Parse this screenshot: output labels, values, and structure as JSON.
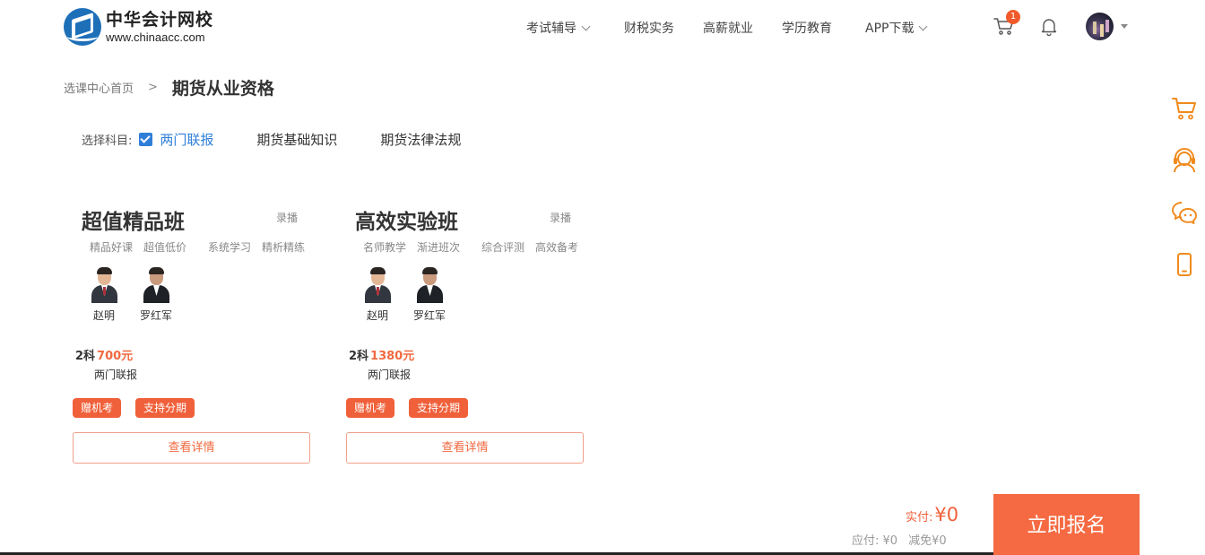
{
  "header": {
    "logo_cn": "中华会计网校",
    "logo_en": "www.chinaacc.com",
    "nav": [
      {
        "label": "考试辅导",
        "dropdown": true
      },
      {
        "label": "财税实务",
        "dropdown": false
      },
      {
        "label": "高薪就业",
        "dropdown": false
      },
      {
        "label": "学历教育",
        "dropdown": false
      },
      {
        "label": "APP下载",
        "dropdown": true
      }
    ],
    "cart_count": "1",
    "icons": [
      "cart-icon",
      "bell-icon",
      "avatar",
      "caret-down-icon"
    ]
  },
  "breadcrumb": {
    "home": "选课中心首页",
    "separator": ">",
    "current": "期货从业资格"
  },
  "subjects": {
    "label": "选择科目:",
    "options": [
      {
        "label": "两门联报",
        "checked": true
      },
      {
        "label": "期货基础知识",
        "checked": false
      },
      {
        "label": "期货法律法规",
        "checked": false
      }
    ]
  },
  "cards": [
    {
      "title": "超值精品班",
      "type": "录播",
      "tags": [
        "精品好课",
        "超值低价",
        "系统学习",
        "精析精练"
      ],
      "teachers": [
        "赵明",
        "罗红军"
      ],
      "count": "2科",
      "price": "700元",
      "desc": "两门联报",
      "badges": [
        "赠机考",
        "支持分期"
      ],
      "button": "查看详情"
    },
    {
      "title": "高效实验班",
      "type": "录播",
      "tags": [
        "名师教学",
        "渐进班次",
        "综合评测",
        "高效备考"
      ],
      "teachers": [
        "赵明",
        "罗红军"
      ],
      "count": "2科",
      "price": "1380元",
      "desc": "两门联报",
      "badges": [
        "赠机考",
        "支持分期"
      ],
      "button": "查看详情"
    }
  ],
  "sidebar": {
    "icons": [
      "cart-icon",
      "customer-service-icon",
      "wechat-icon",
      "mobile-icon"
    ],
    "accent": "#f08a1c"
  },
  "checkout": {
    "paid_label": "实付:",
    "paid_amount": "¥0",
    "due": "应付: ¥0",
    "discount": "减免¥0",
    "enroll": "立即报名"
  },
  "colors": {
    "accent": "#f06a3f",
    "link": "#2f7fd8"
  }
}
